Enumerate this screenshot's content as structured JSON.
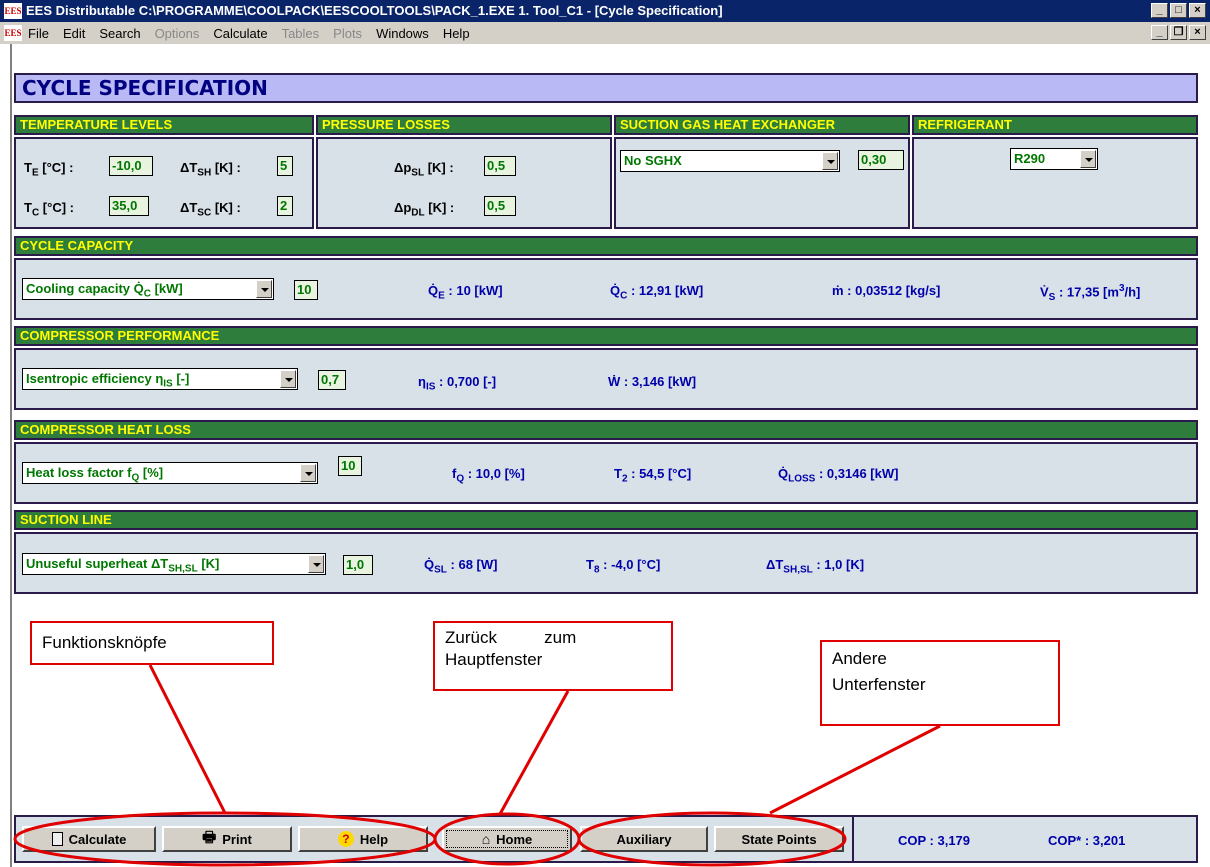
{
  "window": {
    "title": "EES Distributable  C:\\PROGRAMME\\COOLPACK\\EESCOOLTOOLS\\PACK_1.EXE   1. Tool_C1 - [Cycle Specification]",
    "logo_text": "EES"
  },
  "menu": {
    "items": [
      {
        "label": "File",
        "enabled": true
      },
      {
        "label": "Edit",
        "enabled": true
      },
      {
        "label": "Search",
        "enabled": true
      },
      {
        "label": "Options",
        "enabled": false
      },
      {
        "label": "Calculate",
        "enabled": true
      },
      {
        "label": "Tables",
        "enabled": false
      },
      {
        "label": "Plots",
        "enabled": false
      },
      {
        "label": "Windows",
        "enabled": true
      },
      {
        "label": "Help",
        "enabled": true
      }
    ]
  },
  "header": {
    "title": "CYCLE SPECIFICATION"
  },
  "temperature": {
    "title": "TEMPERATURE LEVELS",
    "te_label": "T",
    "te_sub": "E",
    "te_unit": " [°C] :",
    "te_value": "-10,0",
    "tsh_label": "ΔT",
    "tsh_sub": "SH",
    "tsh_unit": " [K] :",
    "tsh_value": "5",
    "tc_label": "T",
    "tc_sub": "C",
    "tc_unit": " [°C] :",
    "tc_value": "35,0",
    "tsc_label": "ΔT",
    "tsc_sub": "SC",
    "tsc_unit": " [K] :",
    "tsc_value": "2"
  },
  "pressure": {
    "title": "PRESSURE LOSSES",
    "psl_label": "Δp",
    "psl_sub": "SL",
    "psl_unit": " [K] :",
    "psl_value": "0,5",
    "pdl_label": "Δp",
    "pdl_sub": "DL",
    "pdl_unit": " [K] :",
    "pdl_value": "0,5"
  },
  "sghx": {
    "title": "SUCTION GAS HEAT EXCHANGER",
    "selected": "No SGHX",
    "value": "0,30"
  },
  "refrigerant": {
    "title": "REFRIGERANT",
    "selected": "R290"
  },
  "capacity": {
    "title": "CYCLE CAPACITY",
    "selected": "Cooling capacity Q̇",
    "selected_sub": "C",
    "selected_unit": " [kW]",
    "value": "10",
    "qe_label": "Q̇",
    "qe_sub": "E",
    "qe_text": " : 10 [kW]",
    "qc_label": "Q̇",
    "qc_sub": "C",
    "qc_text": " : 12,91 [kW]",
    "m_text": "ṁ : 0,03512 [kg/s]",
    "vs_label": "V̇",
    "vs_sub": "S",
    "vs_text": " : 17,35 [m",
    "vs_sup": "3",
    "vs_end": "/h]"
  },
  "compressor": {
    "title": "COMPRESSOR PERFORMANCE",
    "selected": "Isentropic efficiency η",
    "selected_sub": "IS",
    "selected_unit": " [-]",
    "value": "0,7",
    "eta_label": "η",
    "eta_sub": "IS",
    "eta_text": " : 0,700 [-]",
    "w_text": "Ẇ : 3,146 [kW]"
  },
  "heatloss": {
    "title": "COMPRESSOR HEAT LOSS",
    "selected": "Heat loss factor f",
    "selected_sub": "Q",
    "selected_unit": " [%]",
    "value": "10",
    "fq_label": "f",
    "fq_sub": "Q",
    "fq_text": " : 10,0 [%]",
    "t2_label": "T",
    "t2_sub": "2",
    "t2_text": " : 54,5 [°C]",
    "qloss_label": "Q̇",
    "qloss_sub": "LOSS",
    "qloss_text": " : 0,3146 [kW]"
  },
  "suction": {
    "title": "SUCTION LINE",
    "selected": "Unuseful superheat ΔT",
    "selected_sub": "SH,SL",
    "selected_unit": " [K]",
    "value": "1,0",
    "qsl_label": "Q̇",
    "qsl_sub": "SL",
    "qsl_text": " : 68 [W]",
    "t8_label": "T",
    "t8_sub": "8",
    "t8_text": " : -4,0 [°C]",
    "tsh_label": "ΔT",
    "tsh_sub": "SH,SL",
    "tsh_text": " : 1,0 [K]"
  },
  "callouts": {
    "funktion": "Funktionsknöpfe",
    "zurueck_1": "Zurück          zum",
    "zurueck_2": "Hauptfenster",
    "andere_1": "Andere",
    "andere_2": "Unterfenster"
  },
  "buttons": {
    "calculate": "Calculate",
    "print": "Print",
    "help": "Help",
    "home": "Home",
    "auxiliary": "Auxiliary",
    "state_points": "State Points"
  },
  "cop": {
    "cop_text": "COP : 3,179",
    "cop_star_text": "COP* : 3,201"
  },
  "colors": {
    "title_bar": "#0a246a",
    "section_header": "#2e7d3c",
    "section_text": "#ffff00",
    "panel": "#d8e0e8",
    "main_header": "#b9b9f5",
    "callout": "#e00000"
  }
}
